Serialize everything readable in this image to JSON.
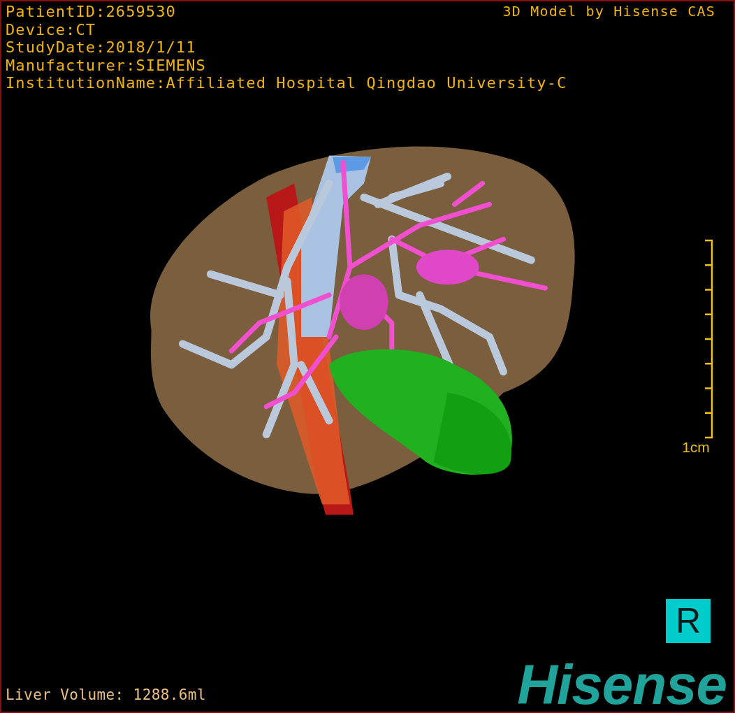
{
  "header": {
    "info": [
      "PatientID:2659530",
      "Device:CT",
      "StudyDate:2018/1/11",
      "Manufacturer:SIEMENS",
      "InstitutionName:Affiliated Hospital Qingdao University-C"
    ],
    "title": "3D Model by Hisense CAS"
  },
  "scale": {
    "label": "1cm"
  },
  "orientation": {
    "label": "R"
  },
  "volume": "Liver Volume: 1288.6ml",
  "logo": "Hisense"
}
